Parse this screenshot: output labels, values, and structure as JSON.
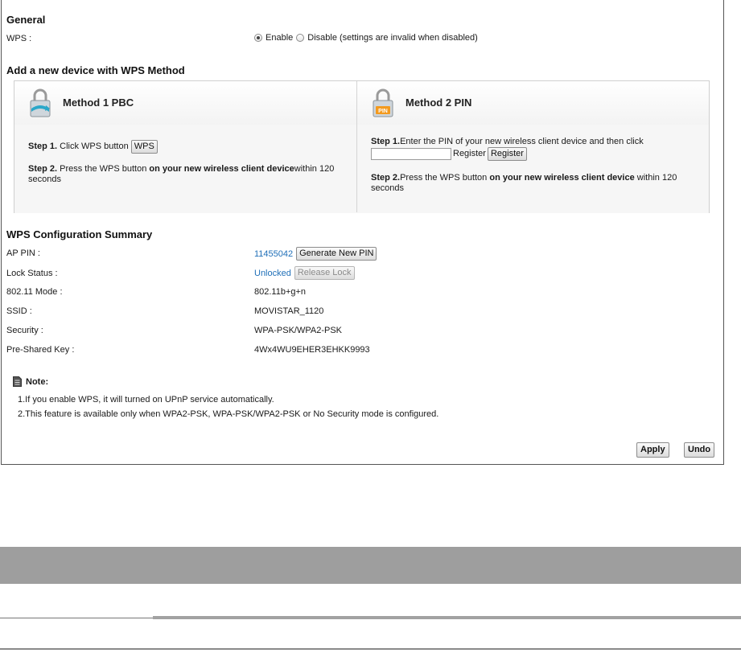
{
  "general": {
    "title": "General",
    "wps_label": "WPS :",
    "enable_label": "Enable",
    "disable_label": "Disable (settings are invalid when disabled)",
    "wps_selected": "Enable"
  },
  "add_device": {
    "title": "Add a new device with WPS Method",
    "method1": {
      "title": "Method 1 PBC",
      "step1_bold": "Step 1.",
      "step1_text": " Click WPS button ",
      "wps_button": "WPS",
      "step2_bold": "Step 2.",
      "step2_text": " Press the WPS button ",
      "step2_bold2": "on your new wireless client device",
      "step2_text2": "within 120 seconds"
    },
    "method2": {
      "title": "Method 2 PIN",
      "lock_badge": "PIN",
      "step1_bold": "Step 1.",
      "step1_text": "Enter the PIN of your new wireless client device and then click",
      "pin_value": "",
      "register_text": "Register",
      "register_button": "Register",
      "step2_bold": "Step 2.",
      "step2_text": "Press the WPS button ",
      "step2_bold2": "on your new wireless client device",
      "step2_text2": " within 120 seconds"
    }
  },
  "summary": {
    "title": "WPS Configuration Summary",
    "rows": [
      {
        "label": "AP PIN :",
        "value": "11455042"
      },
      {
        "label": "Lock Status :",
        "value": "Unlocked"
      },
      {
        "label": "802.11 Mode :",
        "value": "802.11b+g+n"
      },
      {
        "label": "SSID :",
        "value": "MOVISTAR_1120"
      },
      {
        "label": "Security :",
        "value": "WPA-PSK/WPA2-PSK"
      },
      {
        "label": "Pre-Shared Key :",
        "value": "4Wx4WU9EHER3EHKK9993"
      }
    ],
    "generate_button": "Generate New PIN",
    "release_button": "Release Lock"
  },
  "note": {
    "title": "Note:",
    "lines": [
      "1.If you enable WPS, it will turned on UPnP service automatically.",
      "2.This feature is available only when WPA2-PSK, WPA-PSK/WPA2-PSK or No Security mode is configured."
    ]
  },
  "actions": {
    "apply": "Apply",
    "undo": "Undo"
  },
  "colors": {
    "link": "#1f6fb8",
    "lock_teal": "#2aa7c9",
    "lock_orange": "#f39a1e"
  }
}
